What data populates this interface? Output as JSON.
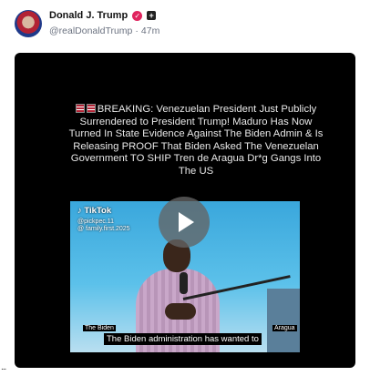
{
  "post": {
    "author_name": "Donald J. Trump",
    "handle": "@realDonaldTrump",
    "separator": "·",
    "time": "47m",
    "verified_icon": "verified-badge-icon",
    "plus_icon": "plus-badge-icon"
  },
  "video": {
    "headline": "BREAKING: Venezuelan President Just Publicly Surrendered to President Trump! Maduro Has Now Turned In State Evidence Against The Biden Admin & Is Releasing PROOF That Biden Asked The Venezuelan Government TO SHIP Tren de Aragua Dr*g Gangs Into The US",
    "tiktok_label": "TikTok",
    "tiktok_user_1": "@pickpec.11",
    "tiktok_user_2": "@ family.first.2025",
    "caption_left": "The Biden",
    "caption_right": "Aragua",
    "caption_main": "The Biden administration has wanted to",
    "play_icon": "play-icon"
  },
  "more": "..."
}
